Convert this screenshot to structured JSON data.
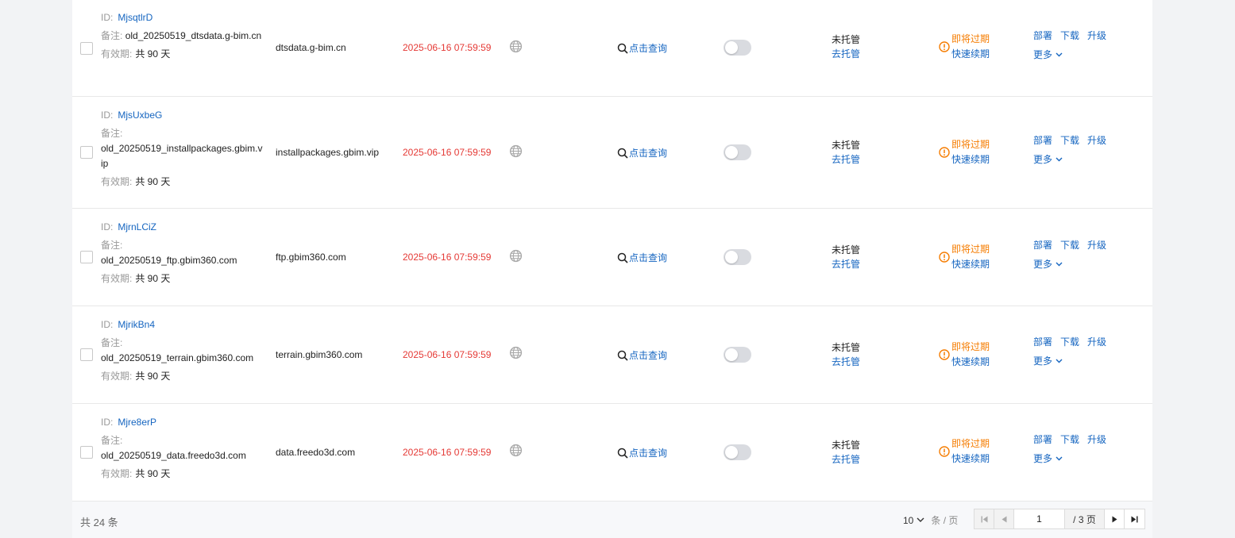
{
  "labels": {
    "id": "ID:",
    "remark": "备注:",
    "validity": "有效期:",
    "query": "点击查询",
    "host_status": "未托管",
    "host_action": "去托管",
    "expiring": "即将过期",
    "renew": "快速续期",
    "deploy": "部署",
    "download": "下载",
    "upgrade": "升级",
    "more": "更多"
  },
  "rows": [
    {
      "id": "MjsqtlrD",
      "remark": "old_20250519_dtsdata.g-bim.cn",
      "days": "共 90 天",
      "domain": "dtsdata.g-bim.cn",
      "expire": "2025-06-16 07:59:59"
    },
    {
      "id": "MjsUxbeG",
      "remark": "old_20250519_installpackages.gbim.vip",
      "days": "共 90 天",
      "domain": "installpackages.gbim.vip",
      "expire": "2025-06-16 07:59:59"
    },
    {
      "id": "MjrnLCiZ",
      "remark": "old_20250519_ftp.gbim360.com",
      "days": "共 90 天",
      "domain": "ftp.gbim360.com",
      "expire": "2025-06-16 07:59:59"
    },
    {
      "id": "MjrikBn4",
      "remark": "old_20250519_terrain.gbim360.com",
      "days": "共 90 天",
      "domain": "terrain.gbim360.com",
      "expire": "2025-06-16 07:59:59"
    },
    {
      "id": "Mjre8erP",
      "remark": "old_20250519_data.freedo3d.com",
      "days": "共 90 天",
      "domain": "data.freedo3d.com",
      "expire": "2025-06-16 07:59:59"
    }
  ],
  "footer": {
    "total": "共 24 条",
    "page_size": "10",
    "page_size_unit": "条 / 页",
    "current_page": "1",
    "total_pages": "/ 3 页"
  },
  "colors": {
    "accent": "#1565c0",
    "danger": "#e53935",
    "warning": "#f57c00"
  },
  "icons": [
    "globe-icon",
    "search-icon",
    "warning-circle-icon",
    "chevron-down-icon",
    "first-page-icon",
    "prev-page-icon",
    "next-page-icon",
    "last-page-icon"
  ]
}
